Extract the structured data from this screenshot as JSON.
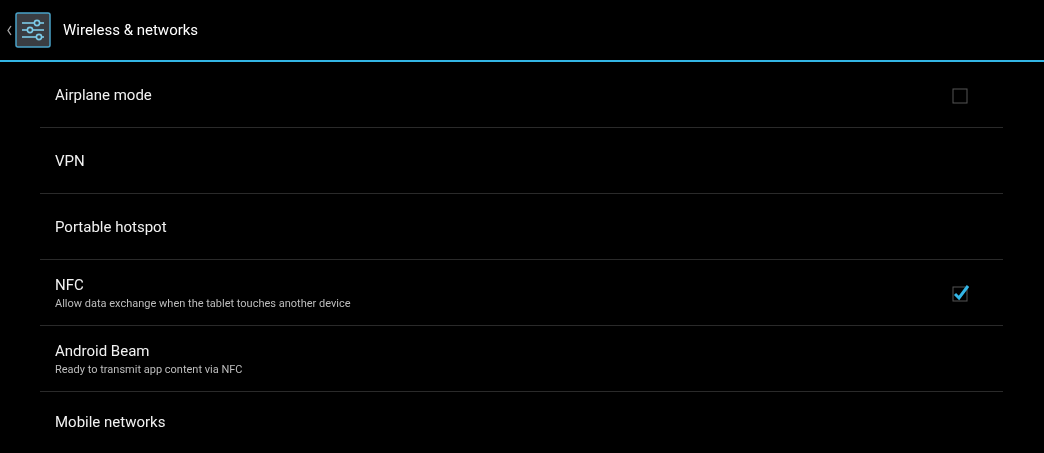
{
  "action_bar": {
    "title": "Wireless & networks"
  },
  "items": [
    {
      "kind": "checkbox",
      "title": "Airplane mode",
      "checked": false
    },
    {
      "kind": "plain",
      "title": "VPN"
    },
    {
      "kind": "plain",
      "title": "Portable hotspot"
    },
    {
      "kind": "checkbox",
      "title": "NFC",
      "summary": "Allow data exchange when the tablet touches another device",
      "checked": true
    },
    {
      "kind": "plain",
      "title": "Android Beam",
      "summary": "Ready to transmit app content via NFC"
    },
    {
      "kind": "plain",
      "title": "Mobile networks"
    }
  ]
}
